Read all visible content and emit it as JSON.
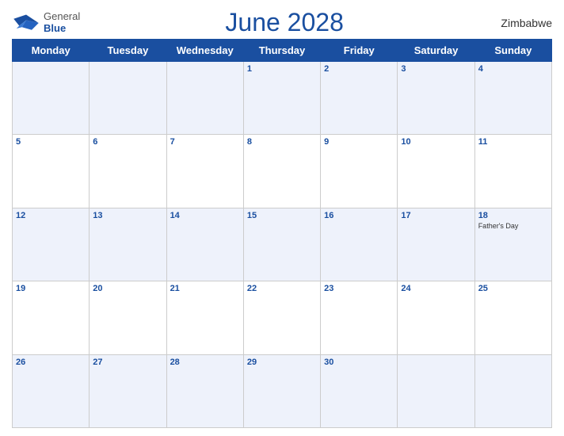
{
  "header": {
    "title": "June 2028",
    "country": "Zimbabwe",
    "logo": {
      "general": "General",
      "blue": "Blue"
    }
  },
  "weekdays": [
    "Monday",
    "Tuesday",
    "Wednesday",
    "Thursday",
    "Friday",
    "Saturday",
    "Sunday"
  ],
  "weeks": [
    [
      {
        "day": "",
        "empty": true
      },
      {
        "day": "",
        "empty": true
      },
      {
        "day": "",
        "empty": true
      },
      {
        "day": "1"
      },
      {
        "day": "2"
      },
      {
        "day": "3"
      },
      {
        "day": "4"
      }
    ],
    [
      {
        "day": "5"
      },
      {
        "day": "6"
      },
      {
        "day": "7"
      },
      {
        "day": "8"
      },
      {
        "day": "9"
      },
      {
        "day": "10"
      },
      {
        "day": "11"
      }
    ],
    [
      {
        "day": "12"
      },
      {
        "day": "13"
      },
      {
        "day": "14"
      },
      {
        "day": "15"
      },
      {
        "day": "16"
      },
      {
        "day": "17"
      },
      {
        "day": "18",
        "holiday": "Father's Day"
      }
    ],
    [
      {
        "day": "19"
      },
      {
        "day": "20"
      },
      {
        "day": "21"
      },
      {
        "day": "22"
      },
      {
        "day": "23"
      },
      {
        "day": "24"
      },
      {
        "day": "25"
      }
    ],
    [
      {
        "day": "26"
      },
      {
        "day": "27"
      },
      {
        "day": "28"
      },
      {
        "day": "29"
      },
      {
        "day": "30"
      },
      {
        "day": "",
        "empty": true
      },
      {
        "day": "",
        "empty": true
      }
    ]
  ],
  "colors": {
    "header_bg": "#1a4fa0",
    "row_odd": "#eef2fb",
    "row_even": "#ffffff"
  }
}
